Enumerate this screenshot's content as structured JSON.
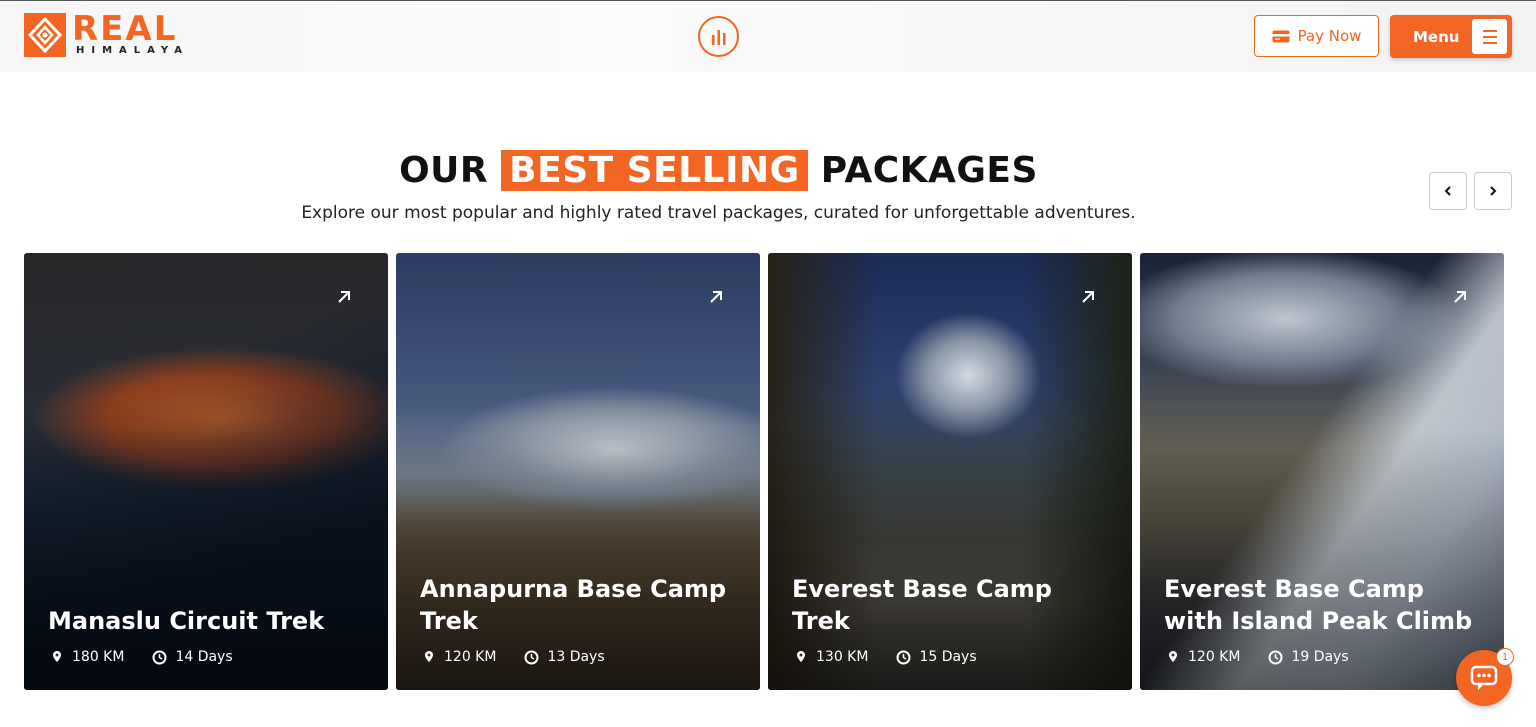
{
  "brand": {
    "name": "REAL",
    "sub": "HIMALAYA",
    "accent": "#f26522"
  },
  "header": {
    "center_icon": "bar-chart-icon",
    "pay_now_label": "Pay Now",
    "menu_label": "Menu"
  },
  "section": {
    "title_before": "OUR",
    "title_highlight": "BEST SELLING",
    "title_after": "PACKAGES",
    "subtitle": "Explore our most popular and highly rated travel packages, curated for unforgettable adventures."
  },
  "packages": [
    {
      "name": "Manaslu Circuit Trek",
      "distance": "180 KM",
      "duration": "14 Days"
    },
    {
      "name": "Annapurna Base Camp Trek",
      "distance": "120 KM",
      "duration": "13 Days"
    },
    {
      "name": "Everest Base Camp Trek",
      "distance": "130 KM",
      "duration": "15 Days"
    },
    {
      "name": "Everest Base Camp with Island Peak Climb",
      "distance": "120 KM",
      "duration": "19 Days"
    }
  ],
  "chat": {
    "badge": "1"
  }
}
